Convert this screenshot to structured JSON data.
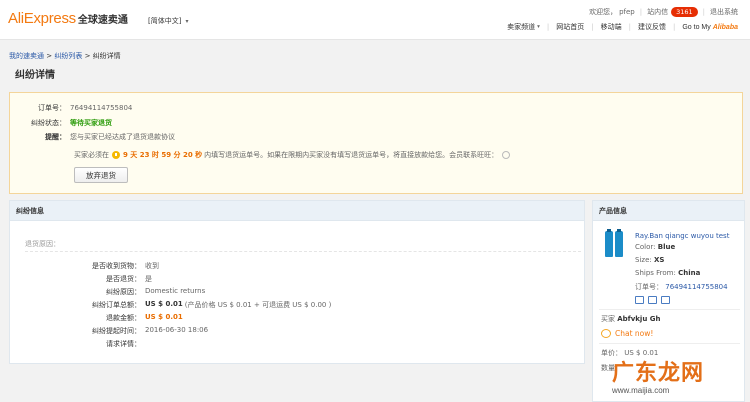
{
  "header": {
    "logo_en": "AliExpress",
    "logo_cn": "全球速卖通",
    "lang": "[简体中文]",
    "welcome": "欢迎您，",
    "user": "pfep",
    "inbox_label": "站内信",
    "inbox_count": "3161",
    "logout": "退出系统",
    "nav": [
      "卖家频道",
      "网站首页",
      "移动端",
      "建议反馈"
    ],
    "goto_prefix": "Go to My",
    "goto_brand": "Alibaba"
  },
  "breadcrumb": {
    "home": "我的速卖通",
    "list": "纠纷列表",
    "current": "纠纷详情",
    "sep": ">"
  },
  "page_title": "纠纷详情",
  "info": {
    "order_label": "订单号：",
    "order_value": "76494114755804",
    "status_label": "纠纷状态：",
    "status_value": "等待买家退货",
    "remind_label": "提醒：",
    "remind_value": "您与买家已经达成了退货退款协议",
    "deadline_prefix": "买家必须在",
    "deadline_time": "9 天 23 时 59 分 20 秒",
    "deadline_suffix": "内填写退货运单号。如果在限期内买家没有填写退货运单号，将直接放款给您。",
    "contact": "会员联系旺旺：",
    "button": "放弃退货"
  },
  "dispute": {
    "header": "纠纷信息",
    "return_reason_label": "退货原因：",
    "rows": [
      {
        "label": "是否收到货物：",
        "value": "收到"
      },
      {
        "label": "是否退货：",
        "value": "是"
      },
      {
        "label": "纠纷原因：",
        "value": "Domestic returns"
      },
      {
        "label": "纠纷订单总额：",
        "value": "US $ 0.01",
        "extra": "(产品价格 US $ 0.01 + 可退运费 US $ 0.00 )"
      },
      {
        "label": "退款金额：",
        "value": "US $ 0.01"
      },
      {
        "label": "纠纷提起时间：",
        "value": "2016-06-30 18:06"
      },
      {
        "label": "请求详情：",
        "value": ""
      }
    ]
  },
  "product": {
    "header": "产品信息",
    "name": "Ray.Ban qiangc wuyou test",
    "color_label": "Color:",
    "color": "Blue",
    "size_label": "Size:",
    "size": "XS",
    "ships_label": "Ships From:",
    "ships": "China",
    "order_label": "订单号：",
    "order": "76494114755804",
    "buyer_label": "买家",
    "buyer": "Abfvkju Gh",
    "chat": "Chat now!",
    "price_label": "单价：",
    "price": "US $ 0.01",
    "qty_label": "数量"
  },
  "watermark": {
    "cn": "广东龙网",
    "url": "www.maijia.com"
  }
}
